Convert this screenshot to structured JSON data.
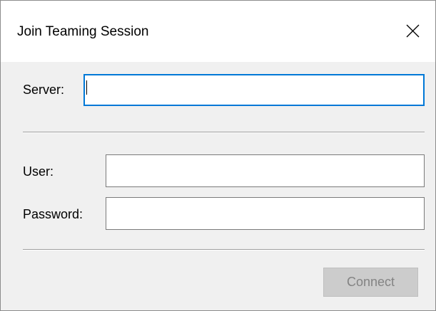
{
  "window": {
    "title": "Join Teaming Session"
  },
  "form": {
    "server_label": "Server:",
    "server_value": "",
    "user_label": "User:",
    "user_value": "",
    "password_label": "Password:",
    "password_value": ""
  },
  "actions": {
    "connect_label": "Connect",
    "connect_enabled": false
  },
  "icons": {
    "close": "close-icon"
  },
  "colors": {
    "focus_border": "#0078d7",
    "dialog_background": "#f0f0f0",
    "disabled_button": "#cccccc",
    "disabled_text": "#838383"
  }
}
